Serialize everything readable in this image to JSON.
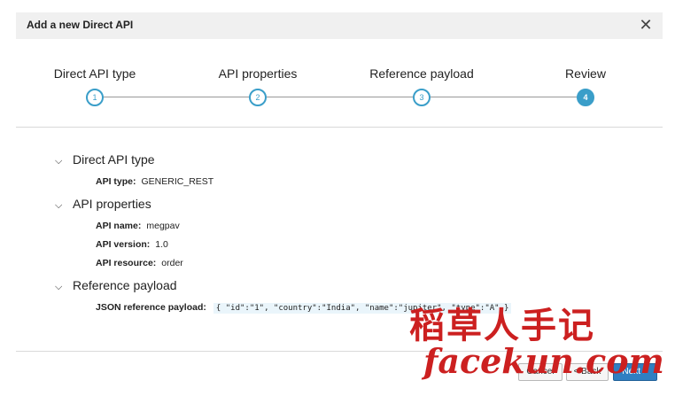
{
  "dialog": {
    "title": "Add a new Direct API",
    "close_glyph": "✕"
  },
  "wizard": {
    "steps": [
      {
        "label": "Direct API type",
        "number": "1"
      },
      {
        "label": "API properties",
        "number": "2"
      },
      {
        "label": "Reference payload",
        "number": "3"
      },
      {
        "label": "Review",
        "number": "4"
      }
    ],
    "active_step": 4
  },
  "review": {
    "sections": [
      {
        "title": "Direct API type",
        "props": [
          {
            "key": "API type:",
            "value": "GENERIC_REST"
          }
        ]
      },
      {
        "title": "API properties",
        "props": [
          {
            "key": "API name:",
            "value": "megpav"
          },
          {
            "key": "API version:",
            "value": "1.0"
          },
          {
            "key": "API resource:",
            "value": "order"
          }
        ]
      },
      {
        "title": "Reference payload",
        "props": [
          {
            "key": "JSON reference payload:",
            "value": "{ \"id\":\"1\", \"country\":\"India\", \"name\":\"jupiter\", \"type\":\"A\" }"
          }
        ]
      }
    ]
  },
  "footer": {
    "cancel_label": "Cancel",
    "back_label": "< Back",
    "next_label": "Next >"
  },
  "watermark": {
    "line1": "稻草人手记",
    "line2": "facekun.com"
  },
  "colors": {
    "accent": "#3a9ec9",
    "primary_button": "#2f7fc2",
    "header_bg": "#f0f0f0",
    "watermark": "#cc2020"
  }
}
